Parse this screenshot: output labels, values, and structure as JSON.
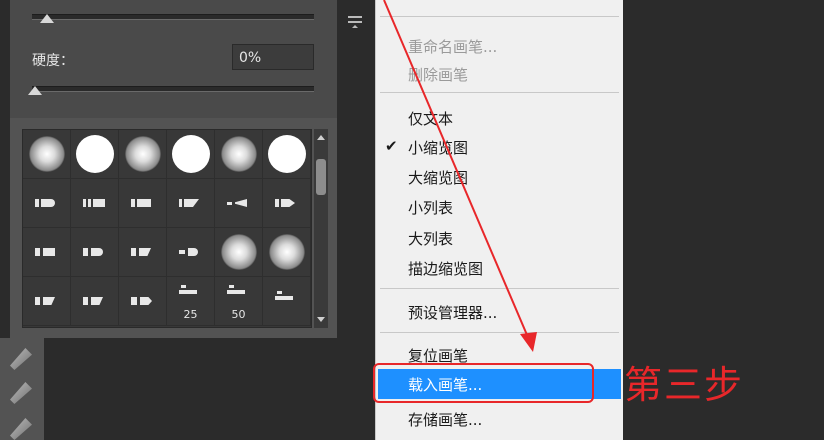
{
  "brush_panel": {
    "hardness_label": "硬度：",
    "hardness_value": "0%",
    "grid_numbers": [
      "25",
      "50"
    ]
  },
  "context_menu": {
    "items": [
      {
        "label": "重命名画笔...",
        "enabled": false
      },
      {
        "label": "删除画笔",
        "enabled": false
      },
      {
        "label": "仅文本",
        "enabled": true
      },
      {
        "label": "小缩览图",
        "enabled": true,
        "checked": true
      },
      {
        "label": "大缩览图",
        "enabled": true
      },
      {
        "label": "小列表",
        "enabled": true
      },
      {
        "label": "大列表",
        "enabled": true
      },
      {
        "label": "描边缩览图",
        "enabled": true
      },
      {
        "label": "预设管理器...",
        "enabled": true
      },
      {
        "label": "复位画笔",
        "enabled": true
      },
      {
        "label": "载入画笔...",
        "enabled": true,
        "highlighted": true
      },
      {
        "label": "存储画笔...",
        "enabled": true
      }
    ],
    "check_mark": "✔"
  },
  "annotation": {
    "step_text": "第三步",
    "color": "#e8272a"
  },
  "colors": {
    "highlight": "#1e90ff",
    "panel_bg": "#535353",
    "menu_bg": "#f0f0f0"
  }
}
